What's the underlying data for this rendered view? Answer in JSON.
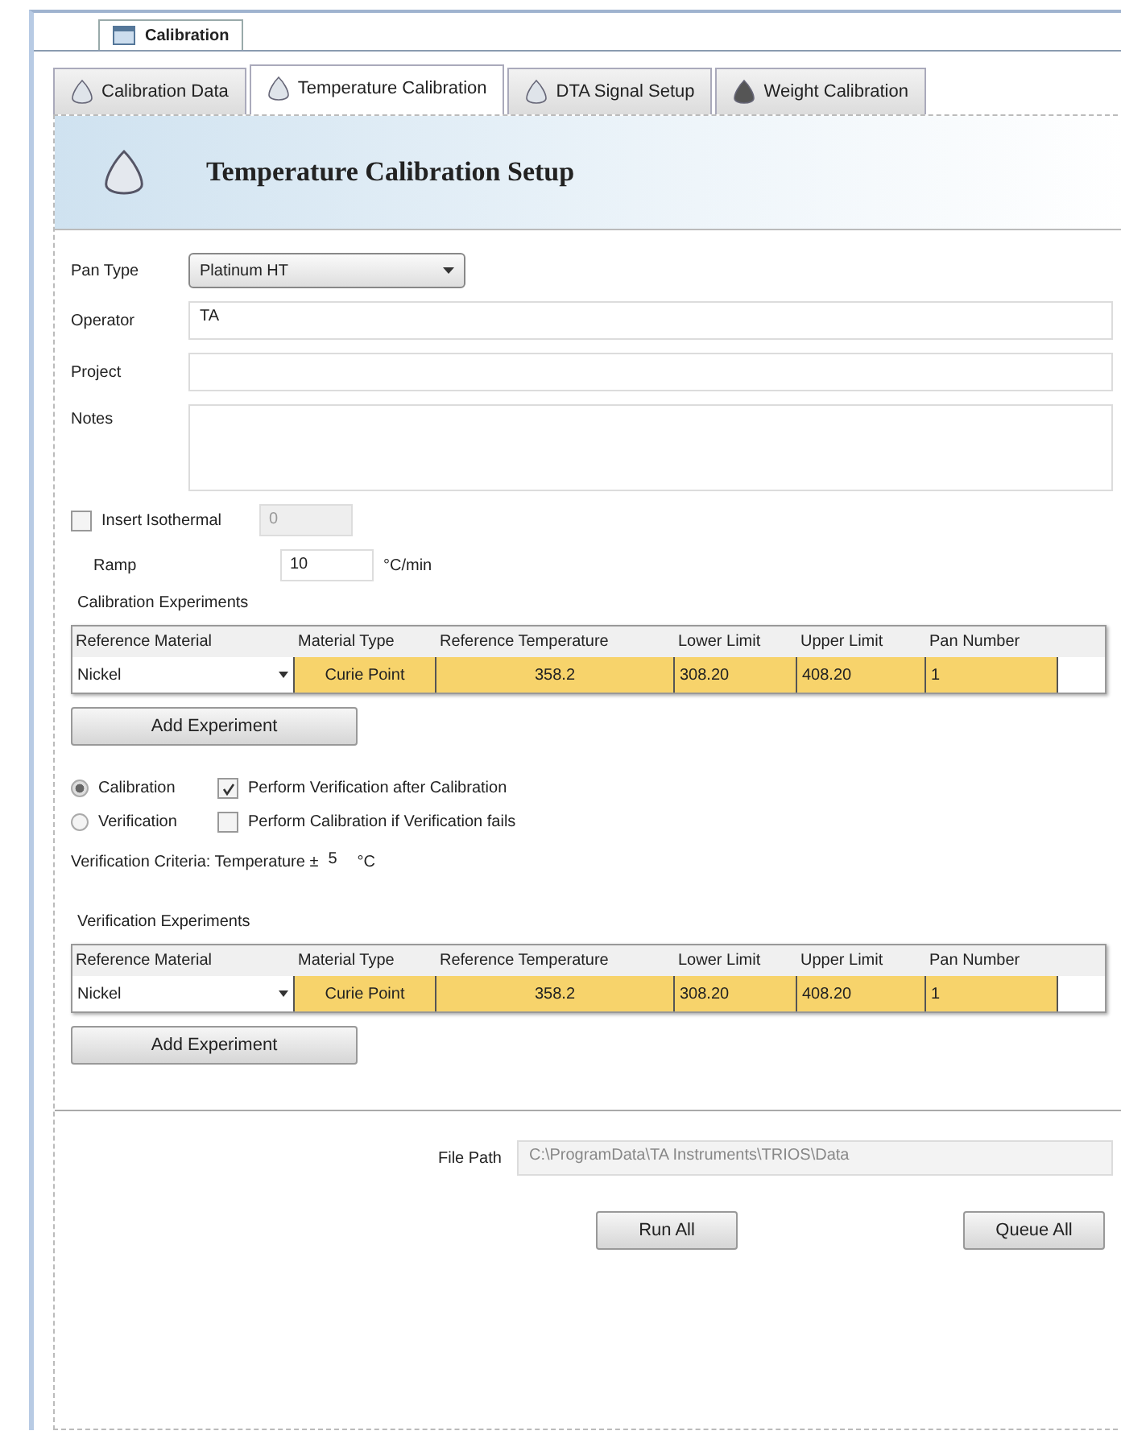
{
  "document_tab": {
    "label": "Calibration",
    "selected": true
  },
  "tabs": [
    {
      "label": "Calibration Data",
      "selected": false,
      "kind": "light"
    },
    {
      "label": "Temperature Calibration",
      "selected": true,
      "kind": "light"
    },
    {
      "label": "DTA Signal Setup",
      "selected": false,
      "kind": "light"
    },
    {
      "label": "Weight Calibration",
      "selected": false,
      "kind": "dark"
    }
  ],
  "header": {
    "title": "Temperature Calibration Setup"
  },
  "form": {
    "pan_type": {
      "label": "Pan Type",
      "value": "Platinum HT"
    },
    "operator": {
      "label": "Operator",
      "value": "TA"
    },
    "project": {
      "label": "Project"
    },
    "notes": {
      "label": "Notes"
    },
    "insert_isothermal": {
      "label": "Insert Isothermal",
      "checked": false,
      "value": "0",
      "disabled": true
    },
    "ramp": {
      "label": "Ramp",
      "value": "10",
      "unit": "°C/min"
    }
  },
  "calibration_experiments": {
    "title": "Calibration Experiments",
    "columns": [
      "Reference Material",
      "Material Type",
      "Reference Temperature",
      "Lower Limit",
      "Upper Limit",
      "Pan Number"
    ],
    "rows": [
      {
        "cells": [
          "Nickel",
          "Curie Point",
          "358.2",
          "308.20",
          "408.20",
          "1"
        ]
      }
    ],
    "button": "Add Experiment"
  },
  "mode": [
    {
      "label": "Calibration",
      "selected": true,
      "option": {
        "label": "Perform Verification after Calibration",
        "checked": true
      }
    },
    {
      "label": "Verification",
      "selected": false,
      "option": {
        "label": "Perform Calibration if Verification fails",
        "checked": false
      }
    }
  ],
  "criteria": {
    "label": "Verification Criteria: Temperature ±",
    "value": "5",
    "unit": "°C"
  },
  "verification_experiments": {
    "title": "Verification Experiments",
    "columns": [
      "Reference Material",
      "Material Type",
      "Reference Temperature",
      "Lower Limit",
      "Upper Limit",
      "Pan Number"
    ],
    "rows": [
      {
        "cells": [
          "Nickel",
          "Curie Point",
          "358.2",
          "308.20",
          "408.20",
          "1"
        ]
      }
    ],
    "button": "Add Experiment"
  },
  "file_path": {
    "label": "File Path",
    "value": "C:\\ProgramData\\TA Instruments\\TRIOS\\Data"
  },
  "buttons": [
    "Run All",
    "Queue All"
  ]
}
